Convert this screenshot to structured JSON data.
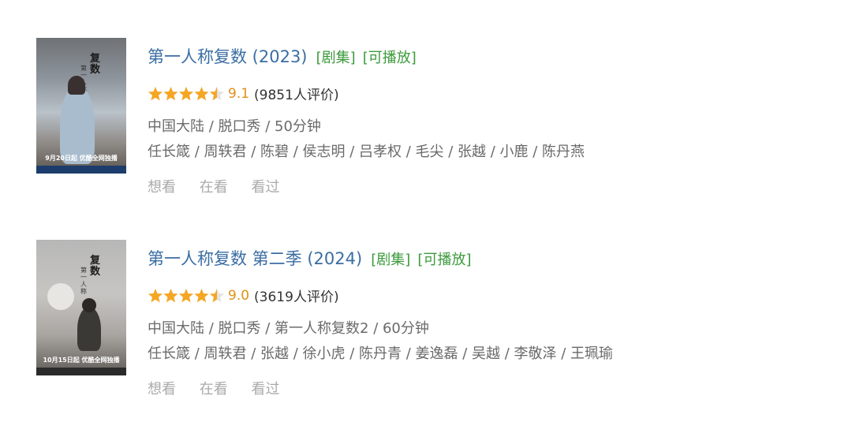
{
  "results": [
    {
      "title": "第一人称复数 (2023)",
      "tag_type": "[剧集]",
      "tag_play": "[可播放]",
      "score": "9.1",
      "rating_count": "(9851人评价)",
      "stars": 4.5,
      "meta": "中国大陆 / 脱口秀 / 50分钟",
      "cast": "任长箴 / 周轶君 / 陈碧 / 侯志明 / 吕孝权 / 毛尖 / 张越 / 小鹿 / 陈丹燕",
      "poster_caption": "9月20日起 优酷全网独播",
      "poster_title": "复数",
      "poster_subtitle": "第一人称",
      "actions": [
        "想看",
        "在看",
        "看过"
      ]
    },
    {
      "title": "第一人称复数 第二季 (2024)",
      "tag_type": "[剧集]",
      "tag_play": "[可播放]",
      "score": "9.0",
      "rating_count": "(3619人评价)",
      "stars": 4.5,
      "meta": "中国大陆 / 脱口秀 / 第一人称复数2 / 60分钟",
      "cast": "任长箴 / 周轶君 / 张越 / 徐小虎 / 陈丹青 / 姜逸磊 / 吴越 / 李敬泽 / 王珮瑜",
      "poster_caption": "10月15日起 优酷全网独播",
      "poster_title": "复数",
      "poster_subtitle": "第一人称",
      "actions": [
        "想看",
        "在看",
        "看过"
      ]
    }
  ],
  "colors": {
    "title": "#3b6ea3",
    "tag": "#3c9a3c",
    "star": "#f5a623",
    "score": "#e09015",
    "meta": "#6a6a6a",
    "action": "#aaaaaa"
  }
}
